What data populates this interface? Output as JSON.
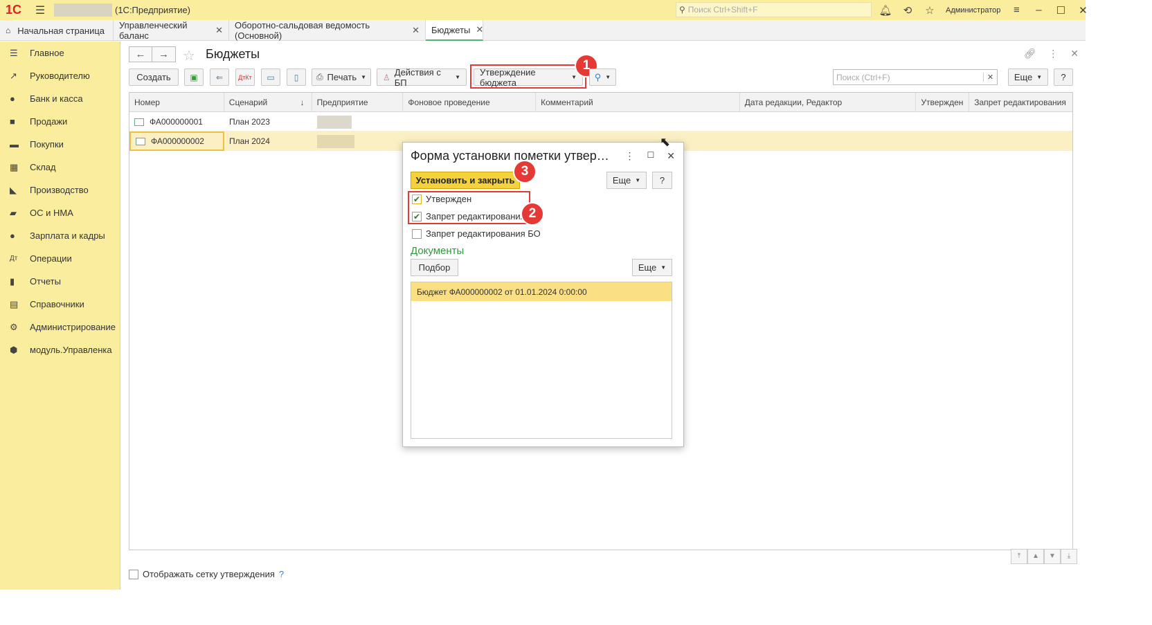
{
  "topbar": {
    "logo": "1С",
    "app_title": "(1С:Предприятие)",
    "search_placeholder": "Поиск Ctrl+Shift+F",
    "user": "Администратор"
  },
  "tabs": [
    {
      "label": "Начальная страница"
    },
    {
      "label": "Управленческий баланс"
    },
    {
      "label": "Оборотно-сальдовая ведомость (Основной)"
    },
    {
      "label": "Бюджеты"
    }
  ],
  "sidebar": {
    "items": [
      {
        "label": "Главное",
        "icon": "menu-icon"
      },
      {
        "label": "Руководителю",
        "icon": "chart-up-icon"
      },
      {
        "label": "Банк и касса",
        "icon": "coin-icon"
      },
      {
        "label": "Продажи",
        "icon": "bag-icon"
      },
      {
        "label": "Покупки",
        "icon": "cart-icon"
      },
      {
        "label": "Склад",
        "icon": "grid-icon"
      },
      {
        "label": "Производство",
        "icon": "factory-icon"
      },
      {
        "label": "ОС и НМА",
        "icon": "truck-icon"
      },
      {
        "label": "Зарплата и кадры",
        "icon": "person-icon"
      },
      {
        "label": "Операции",
        "icon": "dt-kt-icon"
      },
      {
        "label": "Отчеты",
        "icon": "bar-chart-icon"
      },
      {
        "label": "Справочники",
        "icon": "book-icon"
      },
      {
        "label": "Администрирование",
        "icon": "gear-icon"
      },
      {
        "label": "модуль.Управленка",
        "icon": "cube-icon"
      }
    ]
  },
  "page": {
    "title": "Бюджеты"
  },
  "toolbar": {
    "create": "Создать",
    "print": "Печать",
    "bp_actions": "Действия с БП",
    "approve_budget": "Утверждение бюджета",
    "search_placeholder": "Поиск (Ctrl+F)",
    "more": "Еще",
    "help": "?"
  },
  "table": {
    "columns": [
      "Номер",
      "Сценарий",
      "Предприятие",
      "Фоновое проведение",
      "Комментарий",
      "Дата редакции, Редактор",
      "Утвержден",
      "Запрет редактирования"
    ],
    "rows": [
      {
        "number": "ФА000000001",
        "scenario": "План 2023"
      },
      {
        "number": "ФА000000002",
        "scenario": "План 2024"
      }
    ]
  },
  "bottom": {
    "show_grid_label": "Отображать сетку утверждения",
    "help": "?"
  },
  "dialog": {
    "title": "Форма установки пометки утвер…",
    "set_and_close": "Установить и закрыть",
    "more": "Еще",
    "help": "?",
    "checkboxes": [
      {
        "label": "Утвержден",
        "checked": true
      },
      {
        "label": "Запрет редактирования",
        "checked": true
      },
      {
        "label": "Запрет редактирования БО",
        "checked": false
      }
    ],
    "documents_label": "Документы",
    "pick": "Подбор",
    "docs_more": "Еще",
    "documents": [
      "Бюджет ФА000000002 от 01.01.2024 0:00:00"
    ]
  },
  "annotations": {
    "badge1": "1",
    "badge2": "2",
    "badge3": "3"
  },
  "colors": {
    "accent_yellow": "#fbed9e",
    "primary_button": "#f5d23b",
    "highlight_red": "#e53935",
    "documents_green": "#2e9a3b"
  }
}
